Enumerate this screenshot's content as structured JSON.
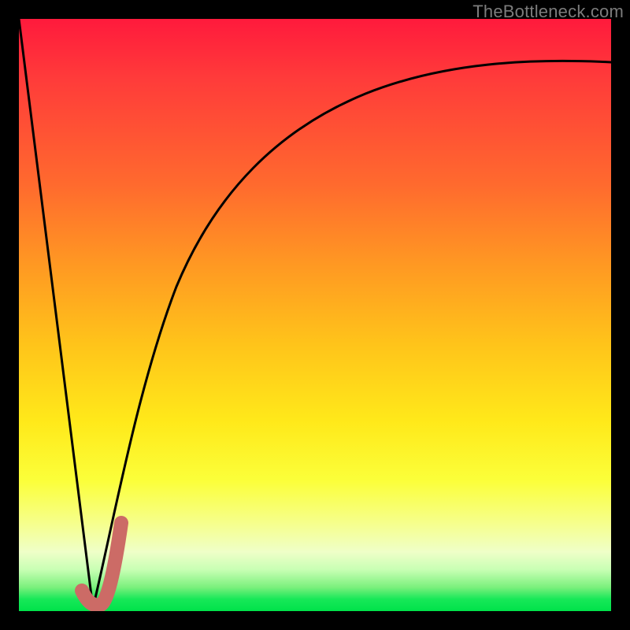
{
  "watermark": "TheBottleneck.com",
  "colors": {
    "frame": "#000000",
    "curve": "#000000",
    "highlight": "#cc6b66",
    "gradient_top": "#ff1a3c",
    "gradient_bottom": "#00e24a"
  },
  "chart_data": {
    "type": "line",
    "title": "",
    "xlabel": "",
    "ylabel": "",
    "xlim": [
      0,
      100
    ],
    "ylim": [
      0,
      100
    ],
    "grid": false,
    "series": [
      {
        "name": "left-descent",
        "x": [
          0,
          12
        ],
        "values": [
          100,
          0
        ]
      },
      {
        "name": "right-arc",
        "x": [
          12,
          15,
          18,
          21,
          25,
          30,
          36,
          44,
          54,
          66,
          80,
          100
        ],
        "values": [
          0,
          12,
          24,
          35,
          46,
          56,
          65,
          73,
          80,
          85,
          89,
          92
        ]
      },
      {
        "name": "highlight-segment",
        "x": [
          11,
          13,
          16.5
        ],
        "values": [
          3,
          0.5,
          15
        ]
      }
    ],
    "annotations": []
  }
}
